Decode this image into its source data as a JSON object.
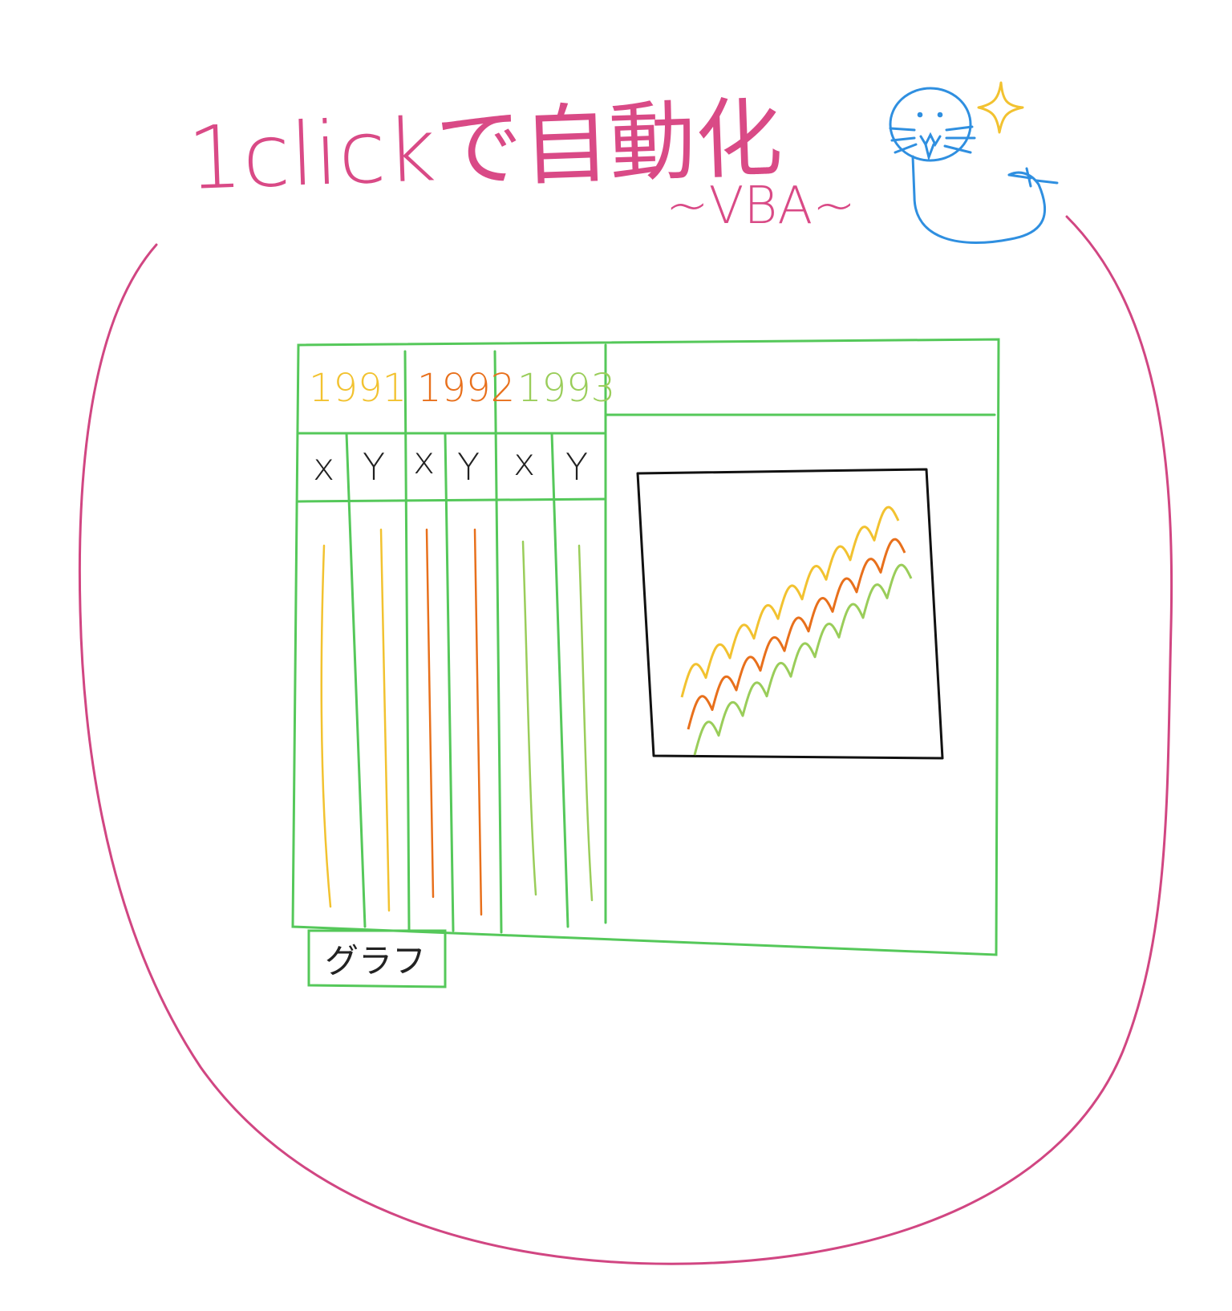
{
  "title": {
    "main": "1clickで自動化",
    "sub": "~VBA~"
  },
  "table": {
    "years": [
      {
        "label": "1991",
        "color": "#F2C230"
      },
      {
        "label": "1992",
        "color": "#E8701C"
      },
      {
        "label": "1993",
        "color": "#9ACD5A"
      }
    ],
    "column_labels": [
      "x",
      "Y",
      "x",
      "Y",
      "x",
      "Y"
    ],
    "grid_color": "#55C85A"
  },
  "button": {
    "label": "グラフ"
  },
  "colors": {
    "title": "#D94A86",
    "blob_outline": "#D14682",
    "chart_frame": "#111111",
    "mascot": "#2F8FE0",
    "sparkle": "#F2C230"
  },
  "icons": {
    "mascot": "seal-mascot-icon",
    "sparkle": "sparkle-icon"
  }
}
